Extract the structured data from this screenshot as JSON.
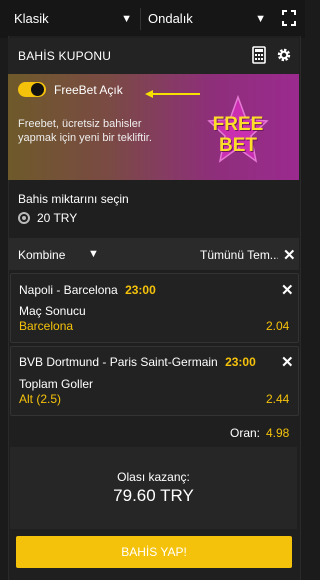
{
  "topbar": {
    "odds_type": "Klasik",
    "format": "Ondalık"
  },
  "header": {
    "title": "BAHİS KUPONU"
  },
  "freebet": {
    "toggle_label": "FreeBet Açık",
    "description_line1": "Freebet, ücretsiz bahisler",
    "description_line2": "yapmak için yeni bir tekliftir.",
    "badge_line1": "FREE",
    "badge_line2": "BET"
  },
  "stake": {
    "label": "Bahis miktarını seçin",
    "option": "20 TRY"
  },
  "bet_type": {
    "label": "Kombine",
    "clear_label": "Tümünü Tem..."
  },
  "selections": [
    {
      "match": "Napoli - Barcelona",
      "time": "23:00",
      "market": "Maç Sonucu",
      "pick": "Barcelona",
      "odds": "2.04"
    },
    {
      "match": "BVB Dortmund - Paris Saint-Germain",
      "time": "23:00",
      "market": "Toplam Goller",
      "pick": "Alt (2.5)",
      "odds": "2.44"
    }
  ],
  "total": {
    "label": "Oran:",
    "value": "4.98"
  },
  "winnings": {
    "label": "Olası kazanç:",
    "amount": "79.60 TRY"
  },
  "submit": {
    "label": "BAHİS YAP!"
  },
  "colors": {
    "accent": "#f5c20b",
    "background": "#1b1b1b"
  }
}
